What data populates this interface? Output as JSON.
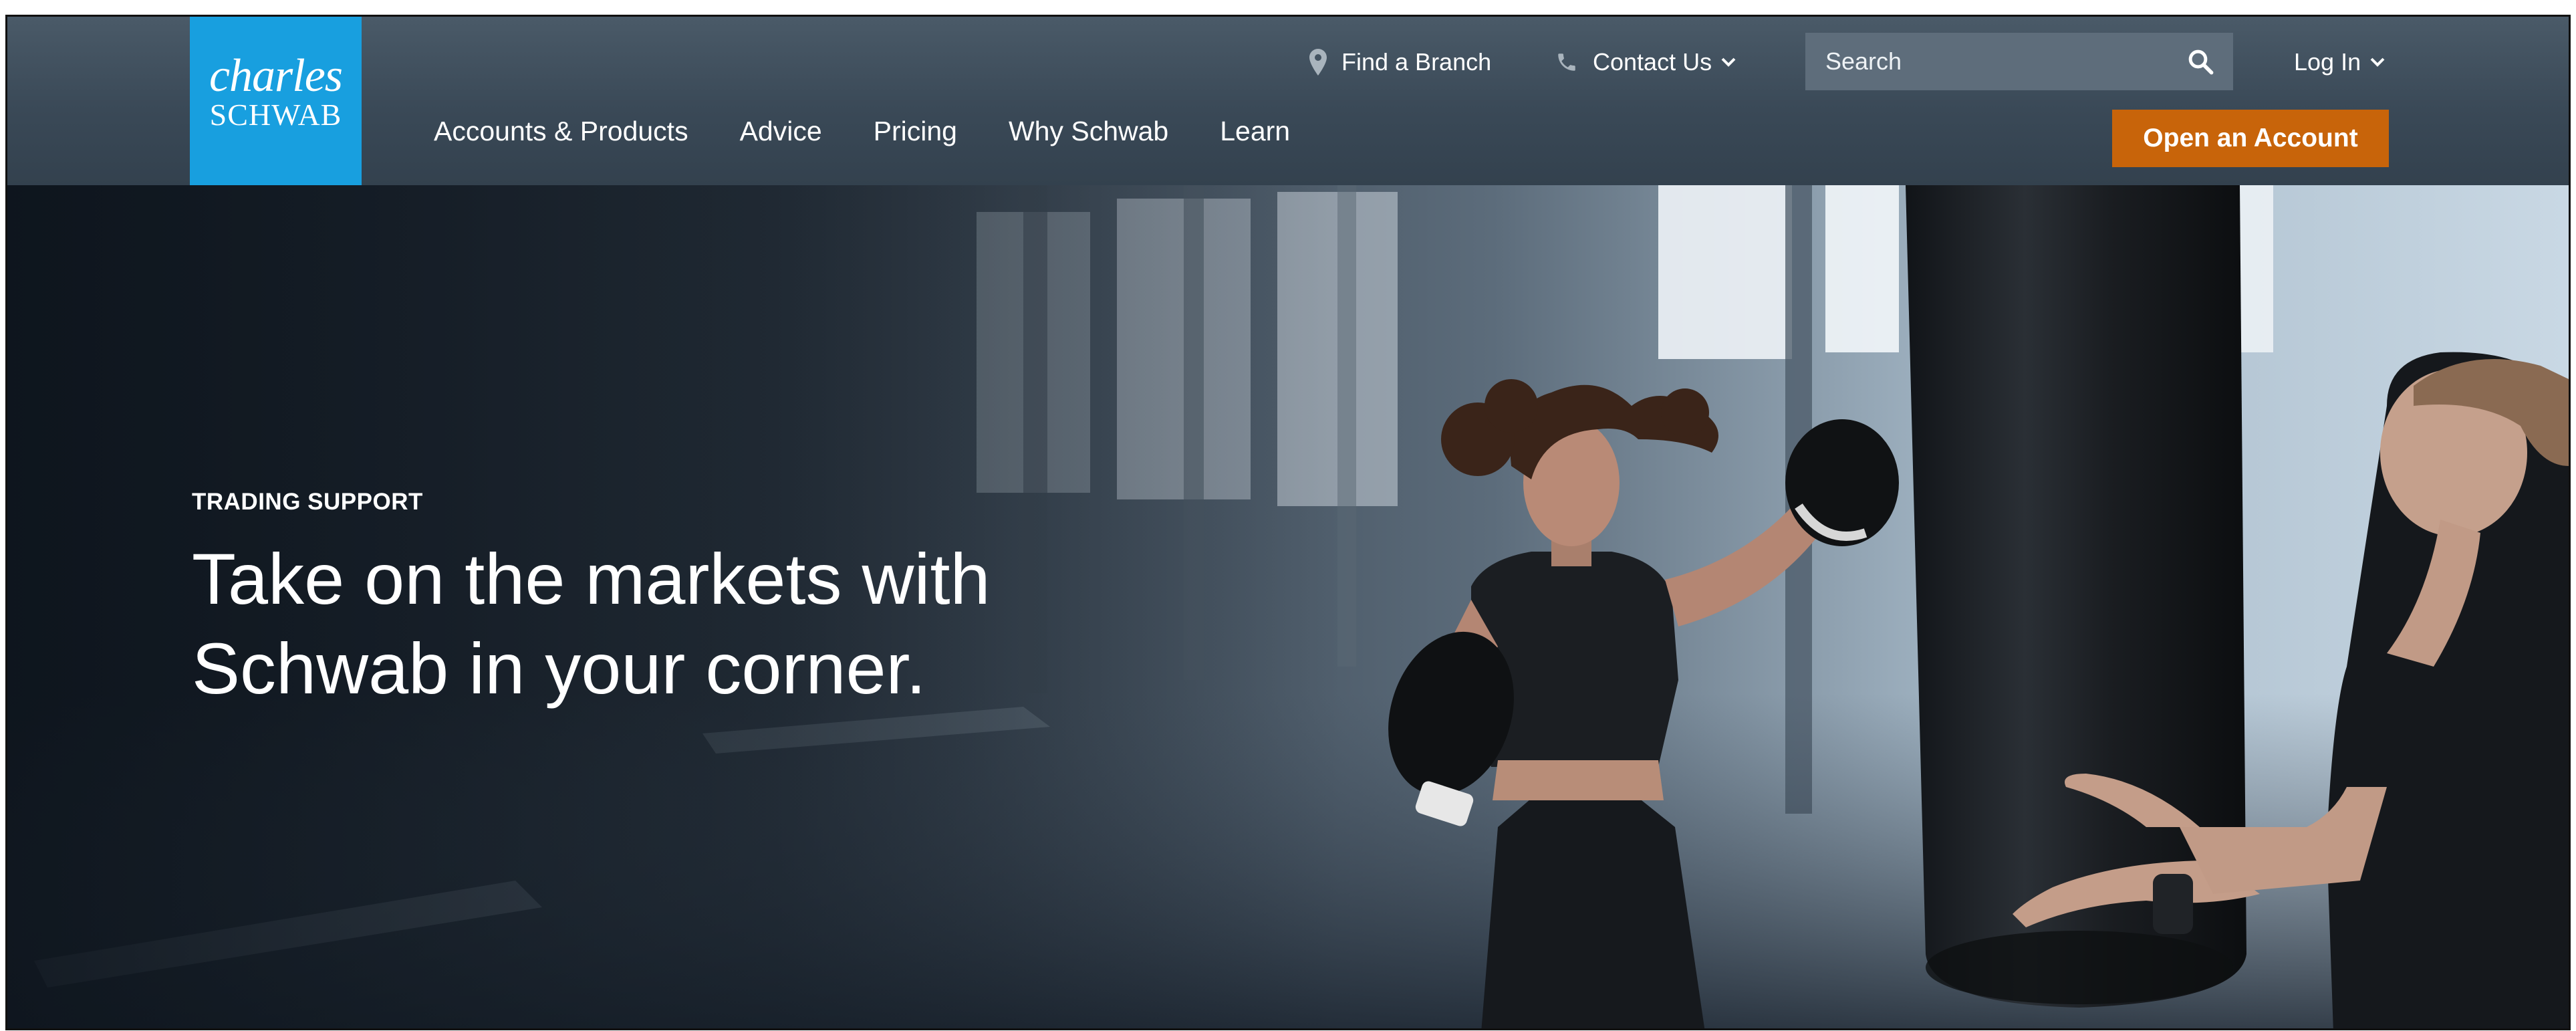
{
  "brand": {
    "line1": "charles",
    "line2": "SCHWAB",
    "color": "#189fdf"
  },
  "utility": {
    "find_branch": "Find a Branch",
    "contact_us": "Contact Us",
    "search_placeholder": "Search",
    "log_in": "Log In",
    "icons": {
      "branch": "map-pin-icon",
      "contact": "phone-icon",
      "search": "magnifier-icon",
      "chevron": "chevron-down-icon"
    }
  },
  "nav": {
    "items": [
      "Accounts & Products",
      "Advice",
      "Pricing",
      "Why Schwab",
      "Learn"
    ]
  },
  "cta": {
    "label": "Open an Account",
    "color": "#c8640a"
  },
  "hero": {
    "eyebrow": "TRADING SUPPORT",
    "headline_line1": "Take on the markets with",
    "headline_line2": "Schwab in your corner."
  },
  "colors": {
    "header_bg": "#3a4957",
    "search_bg": "#5e6d7b"
  }
}
